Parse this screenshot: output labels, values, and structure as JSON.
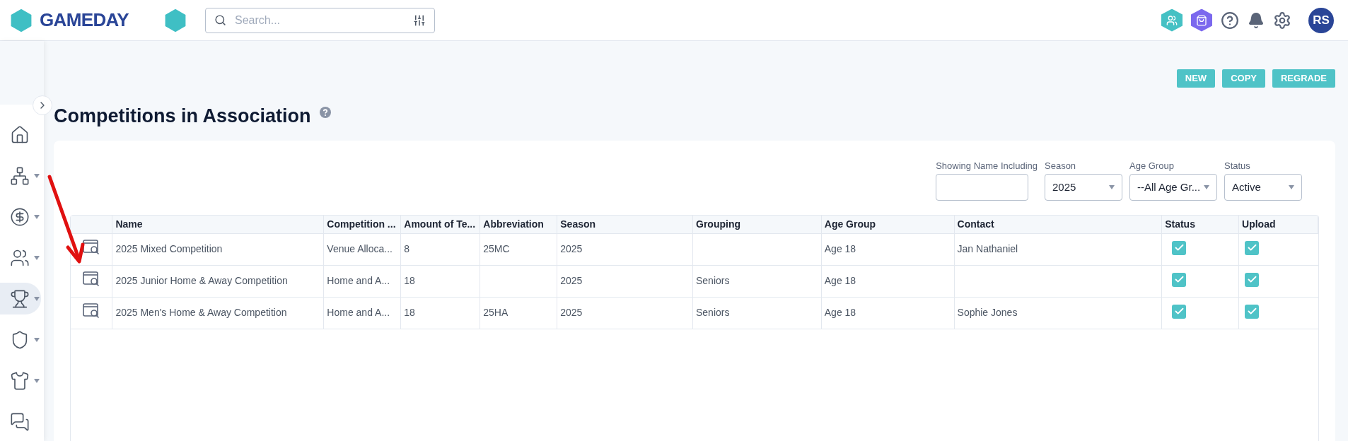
{
  "header": {
    "brand": "GAMEDAY",
    "search": {
      "placeholder": "Search..."
    },
    "avatar": "RS"
  },
  "sidebar": {
    "items": [
      {
        "kind": "home",
        "has_menu": false,
        "selected": false
      },
      {
        "kind": "hierarchy",
        "has_menu": true,
        "selected": false
      },
      {
        "kind": "finance",
        "has_menu": true,
        "selected": false
      },
      {
        "kind": "people",
        "has_menu": true,
        "selected": false
      },
      {
        "kind": "trophy",
        "has_menu": true,
        "selected": true
      },
      {
        "kind": "shield",
        "has_menu": true,
        "selected": false
      },
      {
        "kind": "shirt",
        "has_menu": true,
        "selected": false
      },
      {
        "kind": "chat",
        "has_menu": false,
        "selected": false
      }
    ]
  },
  "actions": [
    "NEW",
    "COPY",
    "REGRADE"
  ],
  "page": {
    "title": "Competitions in Association"
  },
  "filters": [
    {
      "kind": "text",
      "label": "Showing Name Including"
    },
    {
      "kind": "select",
      "label": "Season",
      "value": "2025"
    },
    {
      "kind": "select",
      "label": "Age Group",
      "value": "--All Age Gr..."
    },
    {
      "kind": "select",
      "label": "Status",
      "value": "Active"
    }
  ],
  "table": {
    "columns": [
      "Name",
      "Competition ...",
      "Amount of Te...",
      "Abbreviation",
      "Season",
      "Grouping",
      "Age Group",
      "Contact",
      "Status",
      "Upload"
    ],
    "rows": [
      {
        "name": "2025 Mixed Competition",
        "competition": "Venue Alloca...",
        "amount": "8",
        "abbreviation": "25MC",
        "season": "2025",
        "grouping": "",
        "age_group": "Age 18",
        "contact": "Jan Nathaniel",
        "status": true,
        "upload": true
      },
      {
        "name": "2025 Junior Home & Away Competition",
        "competition": "Home and A...",
        "amount": "18",
        "abbreviation": "",
        "season": "2025",
        "grouping": "Seniors",
        "age_group": "Age 18",
        "contact": "",
        "status": true,
        "upload": true
      },
      {
        "name": "2025 Men's Home & Away Competition",
        "competition": "Home and A...",
        "amount": "18",
        "abbreviation": "25HA",
        "season": "2025",
        "grouping": "Seniors",
        "age_group": "Age 18",
        "contact": "Sophie Jones",
        "status": true,
        "upload": true
      }
    ]
  }
}
